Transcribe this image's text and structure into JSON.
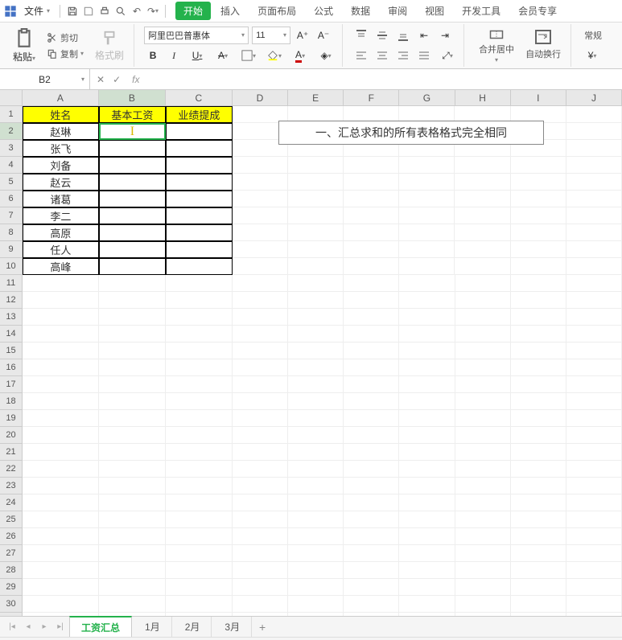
{
  "menu": {
    "file": "文件",
    "tabs": [
      "开始",
      "插入",
      "页面布局",
      "公式",
      "数据",
      "审阅",
      "视图",
      "开发工具",
      "会员专享"
    ],
    "active_tab": 0
  },
  "ribbon": {
    "paste": "粘贴",
    "cut": "剪切",
    "copy": "复制",
    "format_painter": "格式刷",
    "font_name": "阿里巴巴普惠体",
    "font_size": "11",
    "merge": "合并居中",
    "wrap": "自动换行",
    "numfmt": "常规"
  },
  "fx": {
    "name_box": "B2",
    "formula": ""
  },
  "columns": [
    "A",
    "B",
    "C",
    "D",
    "E",
    "F",
    "G",
    "H",
    "I",
    "J"
  ],
  "rows_shown": 31,
  "active_cell": {
    "row": 2,
    "col": "B"
  },
  "headers": [
    "姓名",
    "基本工资",
    "业绩提成"
  ],
  "names": [
    "赵琳",
    "张飞",
    "刘备",
    "赵云",
    "诸葛",
    "李二",
    "高原",
    "任人",
    "高峰"
  ],
  "textbox": "一、汇总求和的所有表格格式完全相同",
  "sheet_tabs": [
    "工资汇总",
    "1月",
    "2月",
    "3月"
  ],
  "active_sheet": 0
}
